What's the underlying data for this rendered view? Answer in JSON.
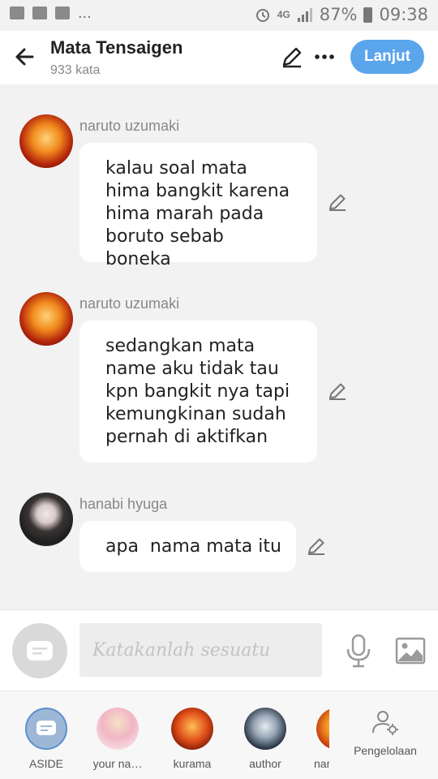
{
  "status_bar": {
    "network": "4G",
    "battery": "87%",
    "time": "09:38",
    "dots": "..."
  },
  "header": {
    "title": "Mata Tensaigen",
    "subtitle": "933 kata",
    "next_label": "Lanjut"
  },
  "messages": [
    {
      "sender": "naruto uzumaki",
      "text": "kalau soal mata hima bangkit karena hima marah pada boruto sebab boneka"
    },
    {
      "sender": "naruto uzumaki",
      "text": "sedangkan mata name aku tidak tau kpn bangkit nya tapi kemungkinan sudah pernah di aktifkan"
    },
    {
      "sender": "hanabi hyuga",
      "text": "apa  nama mata itu"
    }
  ],
  "composer": {
    "placeholder": "Katakanlah sesuatu"
  },
  "characters": [
    {
      "name": "ASIDE"
    },
    {
      "name": "your na…"
    },
    {
      "name": "kurama"
    },
    {
      "name": "author"
    },
    {
      "name": "nar"
    }
  ],
  "management_label": "Pengelolaan",
  "colors": {
    "accent": "#5aa5ec",
    "background": "#f2f2f2",
    "bubble": "#ffffff"
  }
}
